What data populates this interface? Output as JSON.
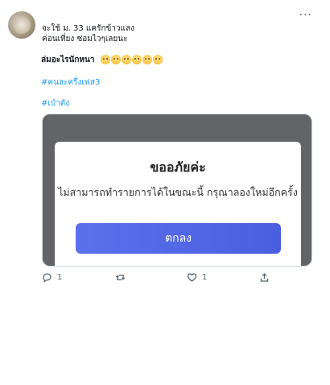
{
  "tweet": {
    "header_line1": "จะใช้ ม. 33 แครักข้าวแลง",
    "header_line2": "ค่อนเที่ยง ซ่อมไวๆเลยนะ",
    "body_text": "ล่มอะไรนักหนา",
    "emoji_count": 6,
    "hashtag1": "#คนละครึ่งเฟส3",
    "hashtag2": "#เป๋าตัง",
    "more_label": "···"
  },
  "dialog": {
    "title": "ขออภัยค่ะ",
    "message": "ไม่สามารถทำรายการได้ในขณะนี้ กรุณาลองใหม่อีกครั้ง",
    "button_label": "ตกลง"
  },
  "actions": {
    "reply_count": "1",
    "retweet_count": "",
    "like_count": "1"
  },
  "colors": {
    "hashtag": "#1d9bf0",
    "dialog_button": "#5166e6",
    "media_background": "#636466",
    "icon": "#536471"
  },
  "icons": [
    "more-icon",
    "reply-icon",
    "retweet-icon",
    "like-icon",
    "share-icon"
  ]
}
